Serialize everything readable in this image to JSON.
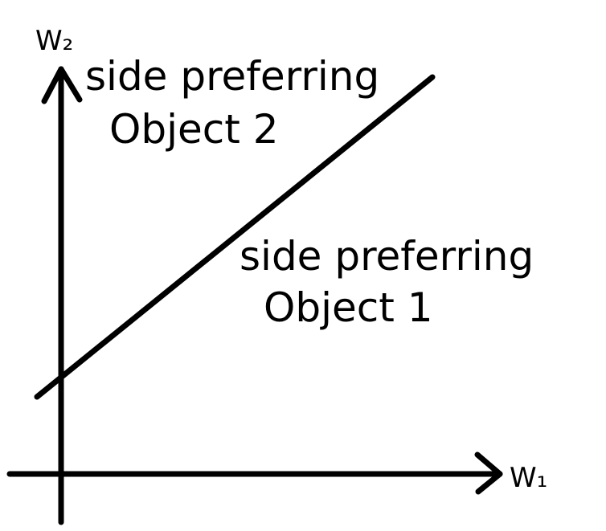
{
  "axes": {
    "x_label": "W₁",
    "y_label": "W₂"
  },
  "regions": {
    "upper": {
      "line1": "side preferring",
      "line2": "Object 2"
    },
    "lower": {
      "line1": "side preferring",
      "line2": "Object 1"
    }
  },
  "colors": {
    "ink": "#000000",
    "background": "#ffffff"
  }
}
